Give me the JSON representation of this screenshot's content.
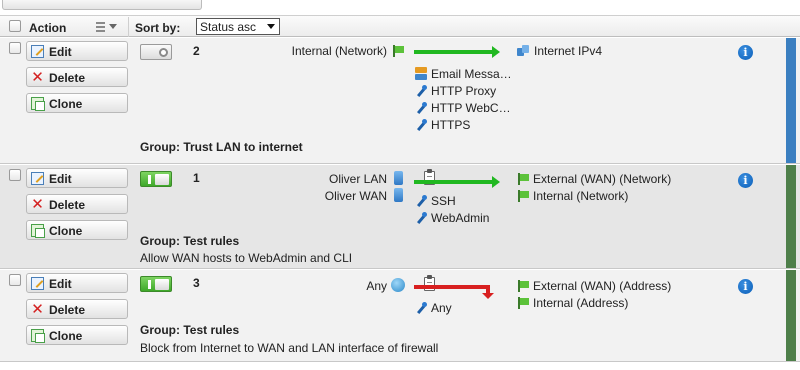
{
  "header": {
    "action_label": "Action",
    "sort_by_label": "Sort by:",
    "sort_value": "Status asc"
  },
  "colors": {
    "strip_blue": "#3b7fc0",
    "strip_green": "#4e7f4a",
    "row_bg_odd": "#f2f2f2",
    "row_bg_even": "#e6e6e6"
  },
  "rows": [
    {
      "edit_label": "Edit",
      "delete_label": "Delete",
      "clone_label": "Clone",
      "enabled": false,
      "position": "2",
      "sources": [
        "Internal (Network)"
      ],
      "source_icon": "network-flag-icon",
      "services": [
        "Email Messa…",
        "HTTP Proxy",
        "HTTP WebC…",
        "HTTPS"
      ],
      "destinations": [
        "Internet IPv4"
      ],
      "action": "allow",
      "group": "Group: Trust LAN to internet",
      "comment": ""
    },
    {
      "edit_label": "Edit",
      "delete_label": "Delete",
      "clone_label": "Clone",
      "enabled": true,
      "position": "1",
      "sources": [
        "Oliver LAN",
        "Oliver WAN"
      ],
      "source_icon": "host-icon",
      "services": [
        "SSH",
        "WebAdmin"
      ],
      "destinations": [
        "External (WAN) (Network)",
        "Internal (Network)"
      ],
      "action": "allow",
      "group": "Group: Test rules",
      "comment": "Allow WAN hosts to WebAdmin and CLI"
    },
    {
      "edit_label": "Edit",
      "delete_label": "Delete",
      "clone_label": "Clone",
      "enabled": true,
      "position": "3",
      "sources": [
        "Any"
      ],
      "source_icon": "globe-icon",
      "services": [
        "Any"
      ],
      "destinations": [
        "External (WAN) (Address)",
        "Internal (Address)"
      ],
      "action": "drop",
      "group": "Group: Test rules",
      "comment": "Block from Internet to WAN and LAN interface of firewall"
    }
  ]
}
